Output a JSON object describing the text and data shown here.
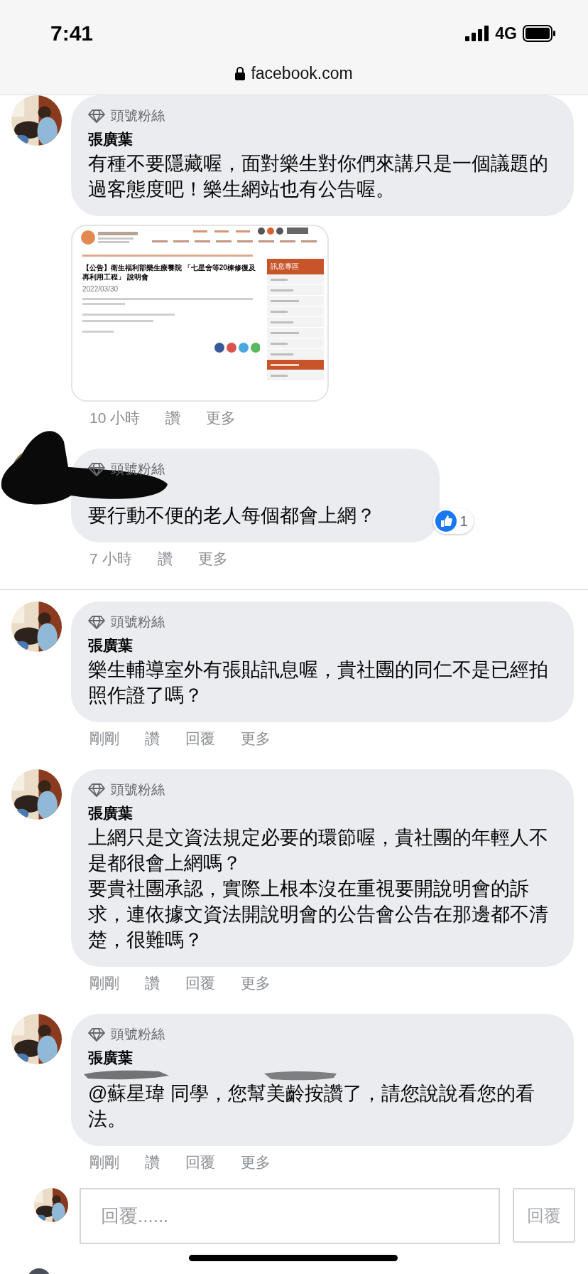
{
  "status_bar": {
    "time": "7:41",
    "network": "4G"
  },
  "address_bar": {
    "url": "facebook.com"
  },
  "threads": [
    {
      "comments": [
        {
          "badge": "頭號粉絲",
          "author": "張廣葉",
          "redacted_author": false,
          "redacted_mention": false,
          "paragraphs": [
            "有種不要隱藏喔，面對樂生對你們來講只是一個議題的過客態度吧！樂生網站也有公告喔。"
          ],
          "attachment": {
            "kind": "web-page",
            "title": "【公告】衛生福利部樂生療養院 「七星舍等20棟修復及再利用工程」 說明會",
            "date": "2022/03/30",
            "sidebar_heading": "訊息專區"
          },
          "time": "10 小時",
          "actions": [
            "讚",
            "更多"
          ]
        },
        {
          "badge": "頭號粉絲",
          "redacted_author": true,
          "redacted_mention": false,
          "paragraphs": [
            "要行動不便的老人每個都會上網？"
          ],
          "reactions": "1",
          "time": "7 小時",
          "actions": [
            "讚",
            "更多"
          ]
        }
      ]
    },
    {
      "comments": [
        {
          "badge": "頭號粉絲",
          "author": "張廣葉",
          "redacted_author": false,
          "redacted_mention": false,
          "paragraphs": [
            "樂生輔導室外有張貼訊息喔，貴社團的同仁不是已經拍照作證了嗎？"
          ],
          "time": "剛剛",
          "actions": [
            "讚",
            "回覆",
            "更多"
          ]
        },
        {
          "badge": "頭號粉絲",
          "author": "張廣葉",
          "redacted_author": false,
          "redacted_mention": false,
          "paragraphs": [
            "上網只是文資法規定必要的環節喔，貴社團的年輕人不是都很會上網嗎？",
            "要貴社團承認，實際上根本沒在重視要開說明會的訴求，連依據文資法開說明會的公告會公告在那邊都不清楚，很難嗎？"
          ],
          "time": "剛剛",
          "actions": [
            "讚",
            "回覆",
            "更多"
          ]
        },
        {
          "badge": "頭號粉絲",
          "author": "張廣葉",
          "redacted_author": false,
          "redacted_mention": true,
          "paragraphs": [
            "@蘇星瑋 同學，您幫美齡按讚了，請您說說看您的看法。"
          ],
          "time": "剛剛",
          "actions": [
            "讚",
            "回覆",
            "更多"
          ]
        }
      ]
    }
  ],
  "reply_box": {
    "placeholder": "回覆......",
    "button": "回覆"
  }
}
